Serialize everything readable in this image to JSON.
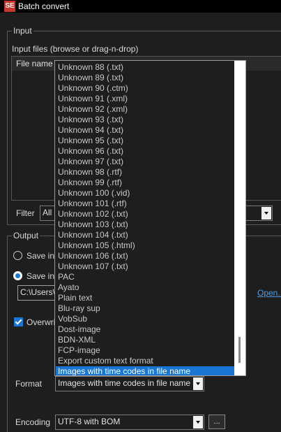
{
  "window": {
    "title": "Batch convert",
    "icon_text": "SE"
  },
  "input": {
    "group_label": "Input",
    "files_label": "Input files (browse or drag-n-drop)",
    "column_file_name": "File name",
    "filter_label": "Filter",
    "filter_value": "All"
  },
  "output": {
    "group_label": "Output",
    "save_in_source": "Save in",
    "save_in_folder": "Save in",
    "folder_path": "C:\\Users\\",
    "open_link": "Open...",
    "overwrite_label": "Overwri"
  },
  "format": {
    "label": "Format",
    "value": "Images with time codes in file name",
    "options": [
      "Unknown 88 (.txt)",
      "Unknown 89 (.txt)",
      "Unknown 90 (.ctm)",
      "Unknown 91 (.xml)",
      "Unknown 92 (.xml)",
      "Unknown 93 (.txt)",
      "Unknown 94 (.txt)",
      "Unknown 95 (.txt)",
      "Unknown 96 (.txt)",
      "Unknown 97 (.txt)",
      "Unknown 98 (.rtf)",
      "Unknown 99 (.rtf)",
      "Unknown 100 (.vid)",
      "Unknown 101 (.rtf)",
      "Unknown 102 (.txt)",
      "Unknown 103 (.txt)",
      "Unknown 104 (.txt)",
      "Unknown 105 (.html)",
      "Unknown 106 (.txt)",
      "Unknown 107 (.txt)",
      "PAC",
      "Ayato",
      "Plain text",
      "Blu-ray sup",
      "VobSub",
      "Dost-image",
      "BDN-XML",
      "FCP-image",
      "Export custom text format",
      "Images with time codes in file name"
    ],
    "selected_option": "Images with time codes in file name"
  },
  "encoding": {
    "label": "Encoding",
    "value": "UTF-8 with BOM",
    "more_button": "..."
  },
  "colors": {
    "accent": "#1976d2",
    "link": "#4d9de0",
    "background": "#1e1e1e",
    "titlebar": "#000000"
  }
}
